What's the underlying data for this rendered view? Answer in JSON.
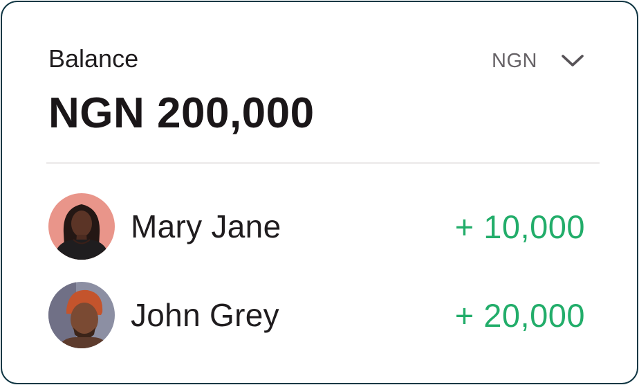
{
  "balance": {
    "label": "Balance",
    "amount": "NGN 200,000",
    "currency": "NGN"
  },
  "transactions": [
    {
      "name": "Mary Jane",
      "amount": "+ 10,000"
    },
    {
      "name": "John Grey",
      "amount": "+ 20,000"
    }
  ],
  "icons": {
    "dropdown": "chevron-down-icon"
  },
  "colors": {
    "border": "#123845",
    "positive_amount": "#22ad6a",
    "text": "#1f1c1e",
    "muted": "#666266"
  }
}
